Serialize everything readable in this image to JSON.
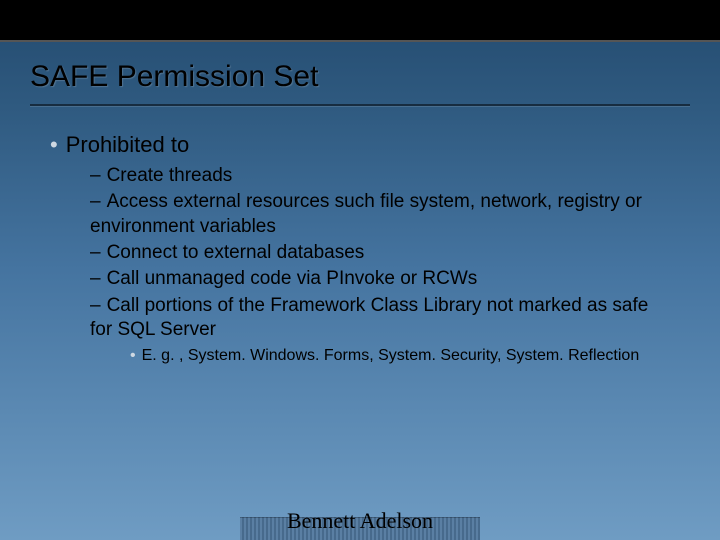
{
  "title": "SAFE Permission Set",
  "heading": "Prohibited to",
  "items": [
    "Create threads",
    "Access external resources such file system, network, registry or environment variables",
    "Connect to external databases",
    "Call unmanaged code via PInvoke or RCWs",
    "Call portions of the Framework Class Library not marked as safe for SQL Server"
  ],
  "subitem": "E. g. , System. Windows. Forms, System. Security, System. Reflection",
  "footer": "Bennett Adelson"
}
